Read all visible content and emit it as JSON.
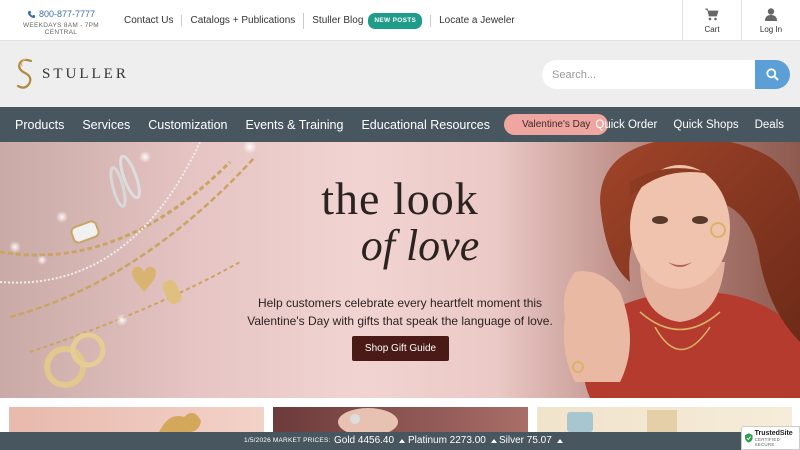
{
  "topbar": {
    "phone": "800-877-7777",
    "hours": "WEEKDAYS 8AM - 7PM CENTRAL",
    "links": [
      {
        "label": "Contact Us"
      },
      {
        "label": "Catalogs + Publications"
      },
      {
        "label": "Stuller Blog",
        "badge": "NEW POSTS"
      },
      {
        "label": "Locate a Jeweler"
      }
    ],
    "cart_label": "Cart",
    "login_label": "Log In"
  },
  "header": {
    "logo_text": "STULLER",
    "search_placeholder": "Search..."
  },
  "nav": {
    "items": [
      "Products",
      "Services",
      "Customization",
      "Events & Training",
      "Educational Resources"
    ],
    "highlight": "Valentine's Day",
    "right_items": [
      "Quick Order",
      "Quick Shops",
      "Deals"
    ]
  },
  "hero": {
    "title_line1": "the look",
    "title_line2": "of love",
    "body": "Help customers celebrate every heartfelt moment this Valentine's Day with gifts that speak the language of love.",
    "cta": "Shop Gift Guide"
  },
  "market": {
    "label": "1/5/2026 MARKET PRICES:",
    "metals": [
      {
        "text": "Gold 4456.40"
      },
      {
        "text": "Platinum 2273.00"
      },
      {
        "text": "Silver 75.07"
      }
    ]
  },
  "trusted": {
    "name": "TrustedSite",
    "sub": "CERTIFIED SECURE"
  },
  "colors": {
    "nav_bg": "#48575f",
    "accent_blue": "#5b9fd6",
    "valentines_pill": "#f0a6a0",
    "cta_bg": "#4a1b16",
    "new_badge": "#1f9c8a"
  }
}
